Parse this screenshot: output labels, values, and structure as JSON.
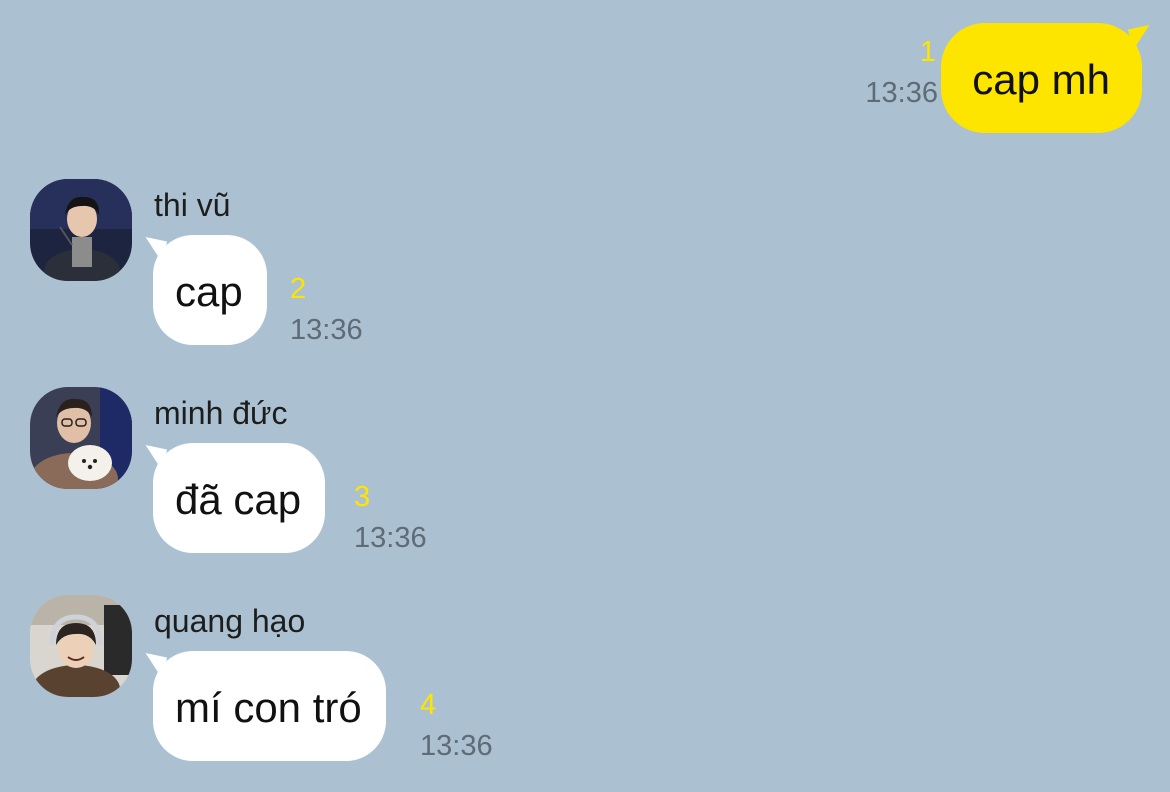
{
  "colors": {
    "background": "#abc1d1",
    "outgoing_bubble": "#fee500",
    "incoming_bubble": "#ffffff",
    "unread_count": "#fee500",
    "timestamp": "#5f6b75"
  },
  "outgoing": {
    "text": "cap mh",
    "unread": "1",
    "time": "13:36"
  },
  "messages": [
    {
      "sender": "thi vũ",
      "text": "cap",
      "unread": "2",
      "time": "13:36",
      "avatar_icon": "profile-photo"
    },
    {
      "sender": "minh đức",
      "text": "đã cap",
      "unread": "3",
      "time": "13:36",
      "avatar_icon": "profile-photo"
    },
    {
      "sender": "quang hạo",
      "text": "mí con tró",
      "unread": "4",
      "time": "13:36",
      "avatar_icon": "profile-photo"
    }
  ]
}
